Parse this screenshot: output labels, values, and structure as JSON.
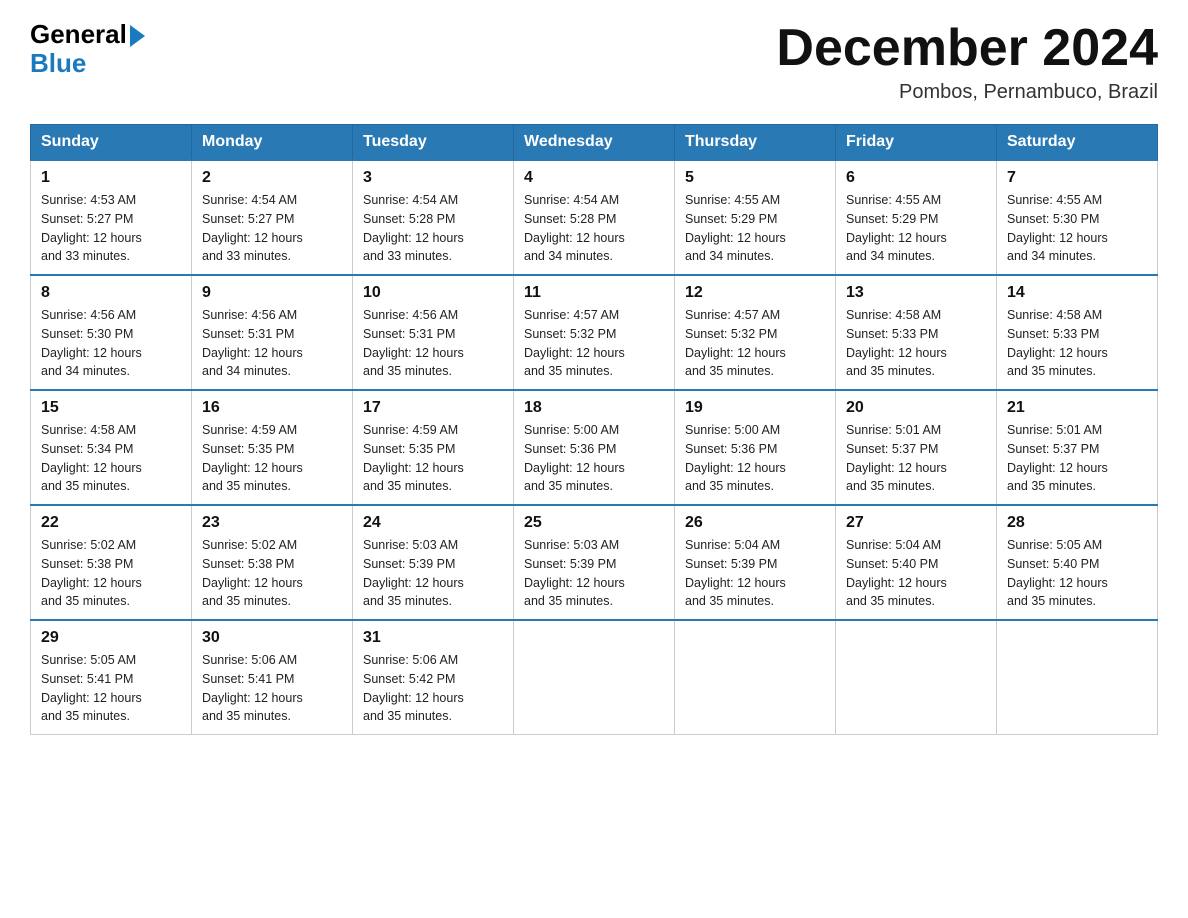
{
  "logo": {
    "general": "General",
    "blue": "Blue",
    "arrow": "▶"
  },
  "header": {
    "month_title": "December 2024",
    "location": "Pombos, Pernambuco, Brazil"
  },
  "days_of_week": [
    "Sunday",
    "Monday",
    "Tuesday",
    "Wednesday",
    "Thursday",
    "Friday",
    "Saturday"
  ],
  "weeks": [
    [
      {
        "day": "1",
        "sunrise": "4:53 AM",
        "sunset": "5:27 PM",
        "daylight": "12 hours and 33 minutes."
      },
      {
        "day": "2",
        "sunrise": "4:54 AM",
        "sunset": "5:27 PM",
        "daylight": "12 hours and 33 minutes."
      },
      {
        "day": "3",
        "sunrise": "4:54 AM",
        "sunset": "5:28 PM",
        "daylight": "12 hours and 33 minutes."
      },
      {
        "day": "4",
        "sunrise": "4:54 AM",
        "sunset": "5:28 PM",
        "daylight": "12 hours and 34 minutes."
      },
      {
        "day": "5",
        "sunrise": "4:55 AM",
        "sunset": "5:29 PM",
        "daylight": "12 hours and 34 minutes."
      },
      {
        "day": "6",
        "sunrise": "4:55 AM",
        "sunset": "5:29 PM",
        "daylight": "12 hours and 34 minutes."
      },
      {
        "day": "7",
        "sunrise": "4:55 AM",
        "sunset": "5:30 PM",
        "daylight": "12 hours and 34 minutes."
      }
    ],
    [
      {
        "day": "8",
        "sunrise": "4:56 AM",
        "sunset": "5:30 PM",
        "daylight": "12 hours and 34 minutes."
      },
      {
        "day": "9",
        "sunrise": "4:56 AM",
        "sunset": "5:31 PM",
        "daylight": "12 hours and 34 minutes."
      },
      {
        "day": "10",
        "sunrise": "4:56 AM",
        "sunset": "5:31 PM",
        "daylight": "12 hours and 35 minutes."
      },
      {
        "day": "11",
        "sunrise": "4:57 AM",
        "sunset": "5:32 PM",
        "daylight": "12 hours and 35 minutes."
      },
      {
        "day": "12",
        "sunrise": "4:57 AM",
        "sunset": "5:32 PM",
        "daylight": "12 hours and 35 minutes."
      },
      {
        "day": "13",
        "sunrise": "4:58 AM",
        "sunset": "5:33 PM",
        "daylight": "12 hours and 35 minutes."
      },
      {
        "day": "14",
        "sunrise": "4:58 AM",
        "sunset": "5:33 PM",
        "daylight": "12 hours and 35 minutes."
      }
    ],
    [
      {
        "day": "15",
        "sunrise": "4:58 AM",
        "sunset": "5:34 PM",
        "daylight": "12 hours and 35 minutes."
      },
      {
        "day": "16",
        "sunrise": "4:59 AM",
        "sunset": "5:35 PM",
        "daylight": "12 hours and 35 minutes."
      },
      {
        "day": "17",
        "sunrise": "4:59 AM",
        "sunset": "5:35 PM",
        "daylight": "12 hours and 35 minutes."
      },
      {
        "day": "18",
        "sunrise": "5:00 AM",
        "sunset": "5:36 PM",
        "daylight": "12 hours and 35 minutes."
      },
      {
        "day": "19",
        "sunrise": "5:00 AM",
        "sunset": "5:36 PM",
        "daylight": "12 hours and 35 minutes."
      },
      {
        "day": "20",
        "sunrise": "5:01 AM",
        "sunset": "5:37 PM",
        "daylight": "12 hours and 35 minutes."
      },
      {
        "day": "21",
        "sunrise": "5:01 AM",
        "sunset": "5:37 PM",
        "daylight": "12 hours and 35 minutes."
      }
    ],
    [
      {
        "day": "22",
        "sunrise": "5:02 AM",
        "sunset": "5:38 PM",
        "daylight": "12 hours and 35 minutes."
      },
      {
        "day": "23",
        "sunrise": "5:02 AM",
        "sunset": "5:38 PM",
        "daylight": "12 hours and 35 minutes."
      },
      {
        "day": "24",
        "sunrise": "5:03 AM",
        "sunset": "5:39 PM",
        "daylight": "12 hours and 35 minutes."
      },
      {
        "day": "25",
        "sunrise": "5:03 AM",
        "sunset": "5:39 PM",
        "daylight": "12 hours and 35 minutes."
      },
      {
        "day": "26",
        "sunrise": "5:04 AM",
        "sunset": "5:39 PM",
        "daylight": "12 hours and 35 minutes."
      },
      {
        "day": "27",
        "sunrise": "5:04 AM",
        "sunset": "5:40 PM",
        "daylight": "12 hours and 35 minutes."
      },
      {
        "day": "28",
        "sunrise": "5:05 AM",
        "sunset": "5:40 PM",
        "daylight": "12 hours and 35 minutes."
      }
    ],
    [
      {
        "day": "29",
        "sunrise": "5:05 AM",
        "sunset": "5:41 PM",
        "daylight": "12 hours and 35 minutes."
      },
      {
        "day": "30",
        "sunrise": "5:06 AM",
        "sunset": "5:41 PM",
        "daylight": "12 hours and 35 minutes."
      },
      {
        "day": "31",
        "sunrise": "5:06 AM",
        "sunset": "5:42 PM",
        "daylight": "12 hours and 35 minutes."
      },
      null,
      null,
      null,
      null
    ]
  ],
  "labels": {
    "sunrise": "Sunrise:",
    "sunset": "Sunset:",
    "daylight": "Daylight:"
  }
}
